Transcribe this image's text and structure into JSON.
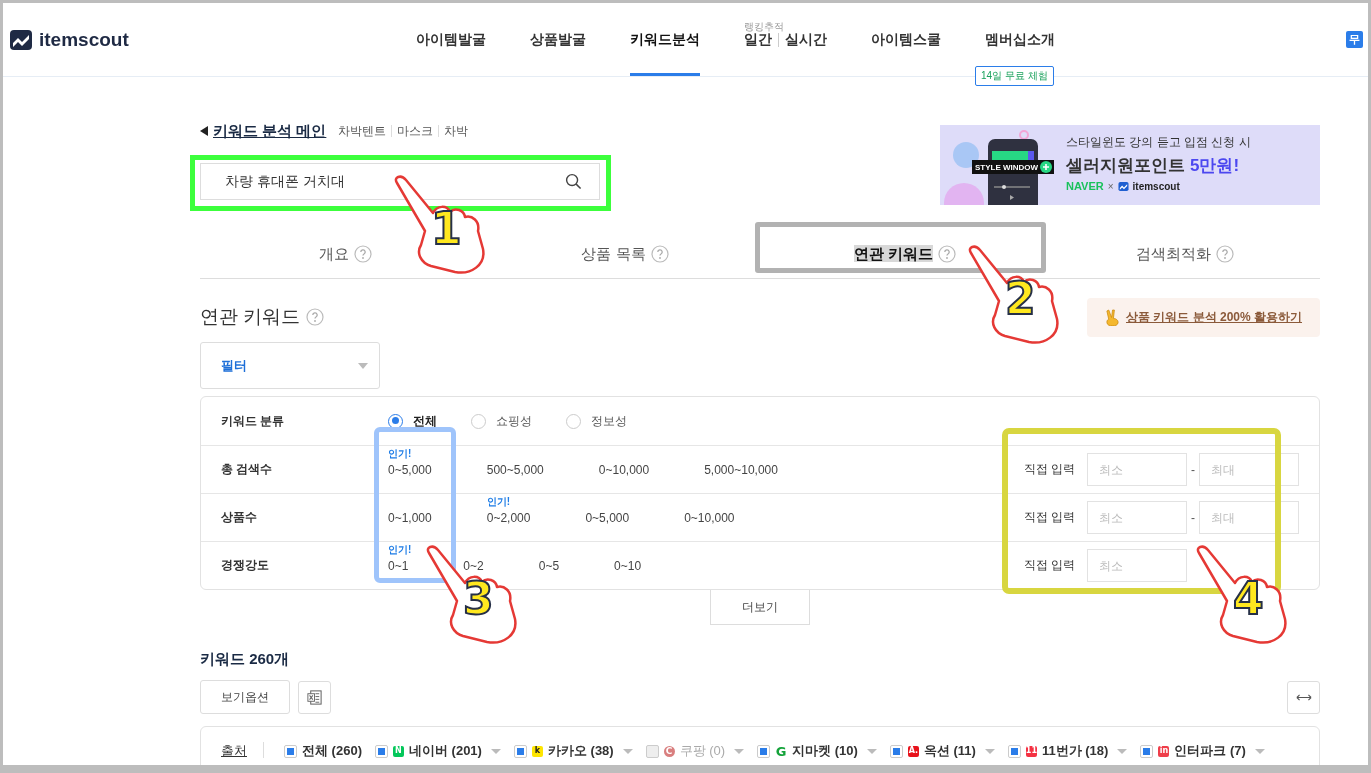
{
  "header": {
    "logo": "itemscout",
    "nav": [
      {
        "kind": "link",
        "label": "아이템발굴",
        "selected": false
      },
      {
        "kind": "link",
        "label": "상품발굴",
        "selected": false
      },
      {
        "kind": "link",
        "label": "키워드분석",
        "selected": true
      },
      {
        "kind": "pair",
        "caption": "랭킹추적",
        "labels": [
          "일간",
          "실시간"
        ],
        "selected": false
      },
      {
        "kind": "link",
        "label": "아이템스쿨",
        "selected": false
      },
      {
        "kind": "link",
        "label": "멤버십소개",
        "selected": false,
        "badge": "14일 무료 체험"
      }
    ],
    "user_badge": "무"
  },
  "breadcrumb": {
    "back_label": "키워드 분석 메인",
    "related": [
      "차박텐트",
      "마스크",
      "차박"
    ]
  },
  "search": {
    "value": "차량 휴대폰 거치대"
  },
  "banner": {
    "line1": "스타일윈도 강의 듣고 입점 신청 시",
    "headline": "셀러지원포인트",
    "highlight": "5만원!",
    "brand1": "NAVER",
    "separator": "×",
    "brand2": "itemscout",
    "phone_tag": "STYLE WINDOW"
  },
  "tabs": [
    {
      "label": "개요",
      "selected": false
    },
    {
      "label": "상품 목록",
      "selected": false
    },
    {
      "label": "연관 키워드",
      "selected": true
    },
    {
      "label": "검색최적화",
      "selected": false
    }
  ],
  "section": {
    "title": "연관 키워드",
    "guide_link": "상품 키워드 분석 200% 활용하기"
  },
  "filter_dropdown": {
    "label": "필터"
  },
  "filter_rows": [
    {
      "kind": "radio",
      "label": "키워드 분류",
      "options": [
        {
          "label": "전체",
          "selected": true
        },
        {
          "label": "쇼핑성",
          "selected": false
        },
        {
          "label": "정보성",
          "selected": false
        }
      ]
    },
    {
      "kind": "range",
      "label": "총 검색수",
      "options": [
        {
          "label": "0~5,000",
          "popular": "인기!"
        },
        {
          "label": "500~5,000"
        },
        {
          "label": "0~10,000"
        },
        {
          "label": "5,000~10,000"
        }
      ],
      "custom": {
        "label": "직접 입력",
        "min_placeholder": "최소",
        "separator": "-",
        "max_placeholder": "최대"
      }
    },
    {
      "kind": "range",
      "label": "상품수",
      "options": [
        {
          "label": "0~1,000"
        },
        {
          "label": "0~2,000",
          "popular": "인기!"
        },
        {
          "label": "0~5,000"
        },
        {
          "label": "0~10,000"
        }
      ],
      "custom": {
        "label": "직접 입력",
        "min_placeholder": "최소",
        "separator": "-",
        "max_placeholder": "최대"
      }
    },
    {
      "kind": "range",
      "label": "경쟁강도",
      "options": [
        {
          "label": "0~1",
          "popular": "인기!"
        },
        {
          "label": "0~2"
        },
        {
          "label": "0~5"
        },
        {
          "label": "0~10"
        }
      ],
      "custom": {
        "label": "직접 입력",
        "min_placeholder": "최소"
      }
    }
  ],
  "more_button": "더보기",
  "keywords": {
    "title": "키워드 260개",
    "view_options": "보기옵션"
  },
  "sources": {
    "label": "출처",
    "items": [
      {
        "label": "전체 (260)",
        "checked": true,
        "disabled": false,
        "menu": false
      },
      {
        "label": "네이버 (201)",
        "checked": true,
        "disabled": false,
        "menu": true,
        "logo": {
          "kind": "square",
          "text": "N",
          "color": "#03c75a"
        }
      },
      {
        "label": "카카오 (38)",
        "checked": true,
        "disabled": false,
        "menu": true,
        "logo": {
          "kind": "lightsquare",
          "text": "k",
          "color": "#fee500"
        }
      },
      {
        "label": "쿠팡 (0)",
        "checked": false,
        "disabled": true,
        "menu": true,
        "logo": {
          "kind": "circle",
          "text": "C",
          "color": "#d97f7f"
        }
      },
      {
        "label": "지마켓 (10)",
        "checked": true,
        "disabled": false,
        "menu": true,
        "logo": {
          "kind": "letter",
          "text": "G",
          "color": "#14a33a"
        }
      },
      {
        "label": "옥션 (11)",
        "checked": true,
        "disabled": false,
        "menu": true,
        "logo": {
          "kind": "square",
          "text": "A.",
          "color": "#e8121b"
        }
      },
      {
        "label": "11번가 (18)",
        "checked": true,
        "disabled": false,
        "menu": true,
        "logo": {
          "kind": "square",
          "text": "11",
          "color": "#f43142"
        }
      },
      {
        "label": "인터파크 (7)",
        "checked": true,
        "disabled": false,
        "menu": true,
        "logo": {
          "kind": "square",
          "text": "in",
          "color": "#ef3e4a"
        }
      }
    ]
  },
  "annotations": {
    "highlights": [
      {
        "color": "#3cff3c"
      },
      {
        "color": "#b2b2b2"
      },
      {
        "color": "#9fc4fb"
      },
      {
        "color": "#d8d640"
      }
    ],
    "pointers": [
      {
        "number": "1"
      },
      {
        "number": "2"
      },
      {
        "number": "3"
      },
      {
        "number": "4"
      }
    ]
  }
}
